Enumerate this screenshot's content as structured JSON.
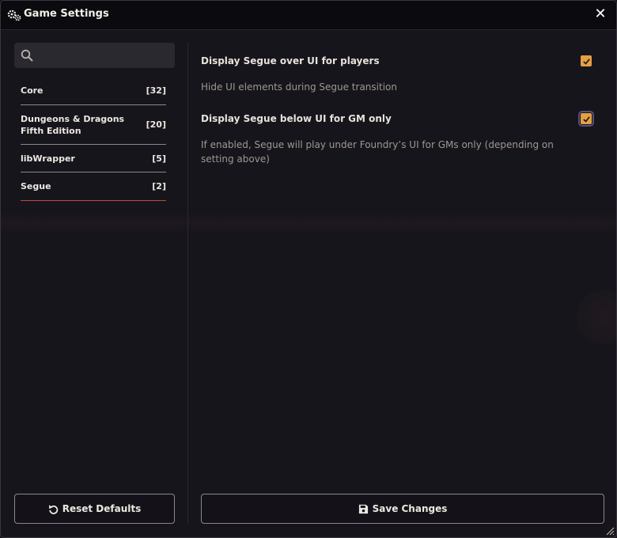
{
  "window": {
    "title": "Game Settings",
    "title_icon": "gears-icon",
    "close_icon": "close-icon",
    "close_glyph": "✕"
  },
  "sidebar": {
    "search": {
      "placeholder": "",
      "value": "",
      "icon": "search-icon"
    },
    "categories": [
      {
        "label": "Core",
        "count": "[32]"
      },
      {
        "label": "Dungeons & Dragons Fifth Edition",
        "count": "[20]"
      },
      {
        "label": "libWrapper",
        "count": "[5]"
      },
      {
        "label": "Segue",
        "count": "[2]",
        "active": true
      }
    ]
  },
  "settings": [
    {
      "title": "Display Segue over UI for players",
      "hint": "Hide UI elements during Segue transition",
      "checked": true
    },
    {
      "title": "Display Segue below UI for GM only",
      "hint": "If enabled, Segue will play under Foundry’s UI for GMs only (depending on setting above)",
      "checked": true
    }
  ],
  "footer": {
    "reset_label": "Reset Defaults",
    "reset_icon": "undo-icon",
    "save_label": "Save Changes",
    "save_icon": "save-icon"
  },
  "colors": {
    "accent": "#e3a044",
    "active_underline": "#c0473a",
    "background": "#17151c",
    "titlebar": "#0b0a0e"
  }
}
